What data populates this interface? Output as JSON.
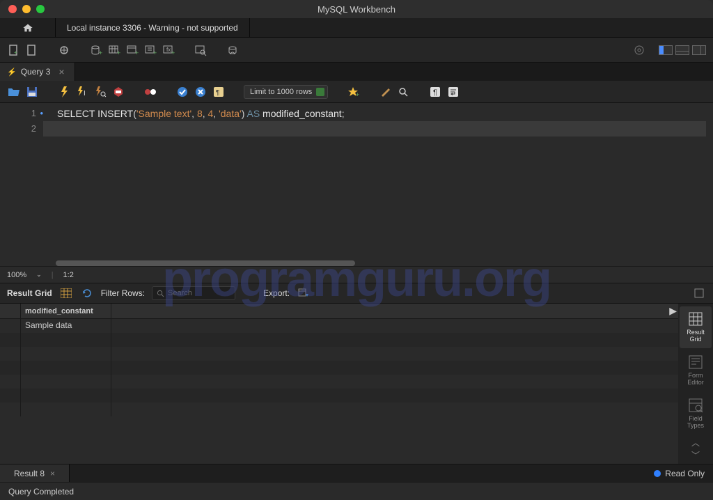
{
  "window": {
    "title": "MySQL Workbench"
  },
  "connection_tab": "Local instance 3306 - Warning - not supported",
  "query_tab": {
    "label": "Query 3"
  },
  "limit": "Limit to 1000 rows",
  "editor": {
    "lines": [
      "1",
      "2"
    ],
    "sql_tokens": {
      "select": "SELECT",
      "insert": "INSERT",
      "lp": "(",
      "str1": "'Sample text'",
      "c1": ", ",
      "n1": "8",
      "c2": ", ",
      "n2": "4",
      "c3": ", ",
      "str2": "'data'",
      "rp": ")",
      "as": " AS ",
      "alias": "modified_constant",
      "semi": ";"
    }
  },
  "zoom": "100%",
  "cursor_pos": "1:2",
  "result": {
    "label": "Result Grid",
    "filter_label": "Filter Rows:",
    "search_placeholder": "Search",
    "export_label": "Export:",
    "column": "modified_constant",
    "value": "Sample data",
    "tab_label": "Result 8",
    "readonly": "Read Only"
  },
  "side_tabs": {
    "grid": "Result\nGrid",
    "form": "Form\nEditor",
    "types": "Field\nTypes"
  },
  "footer": "Query Completed",
  "watermark": "programguru.org"
}
